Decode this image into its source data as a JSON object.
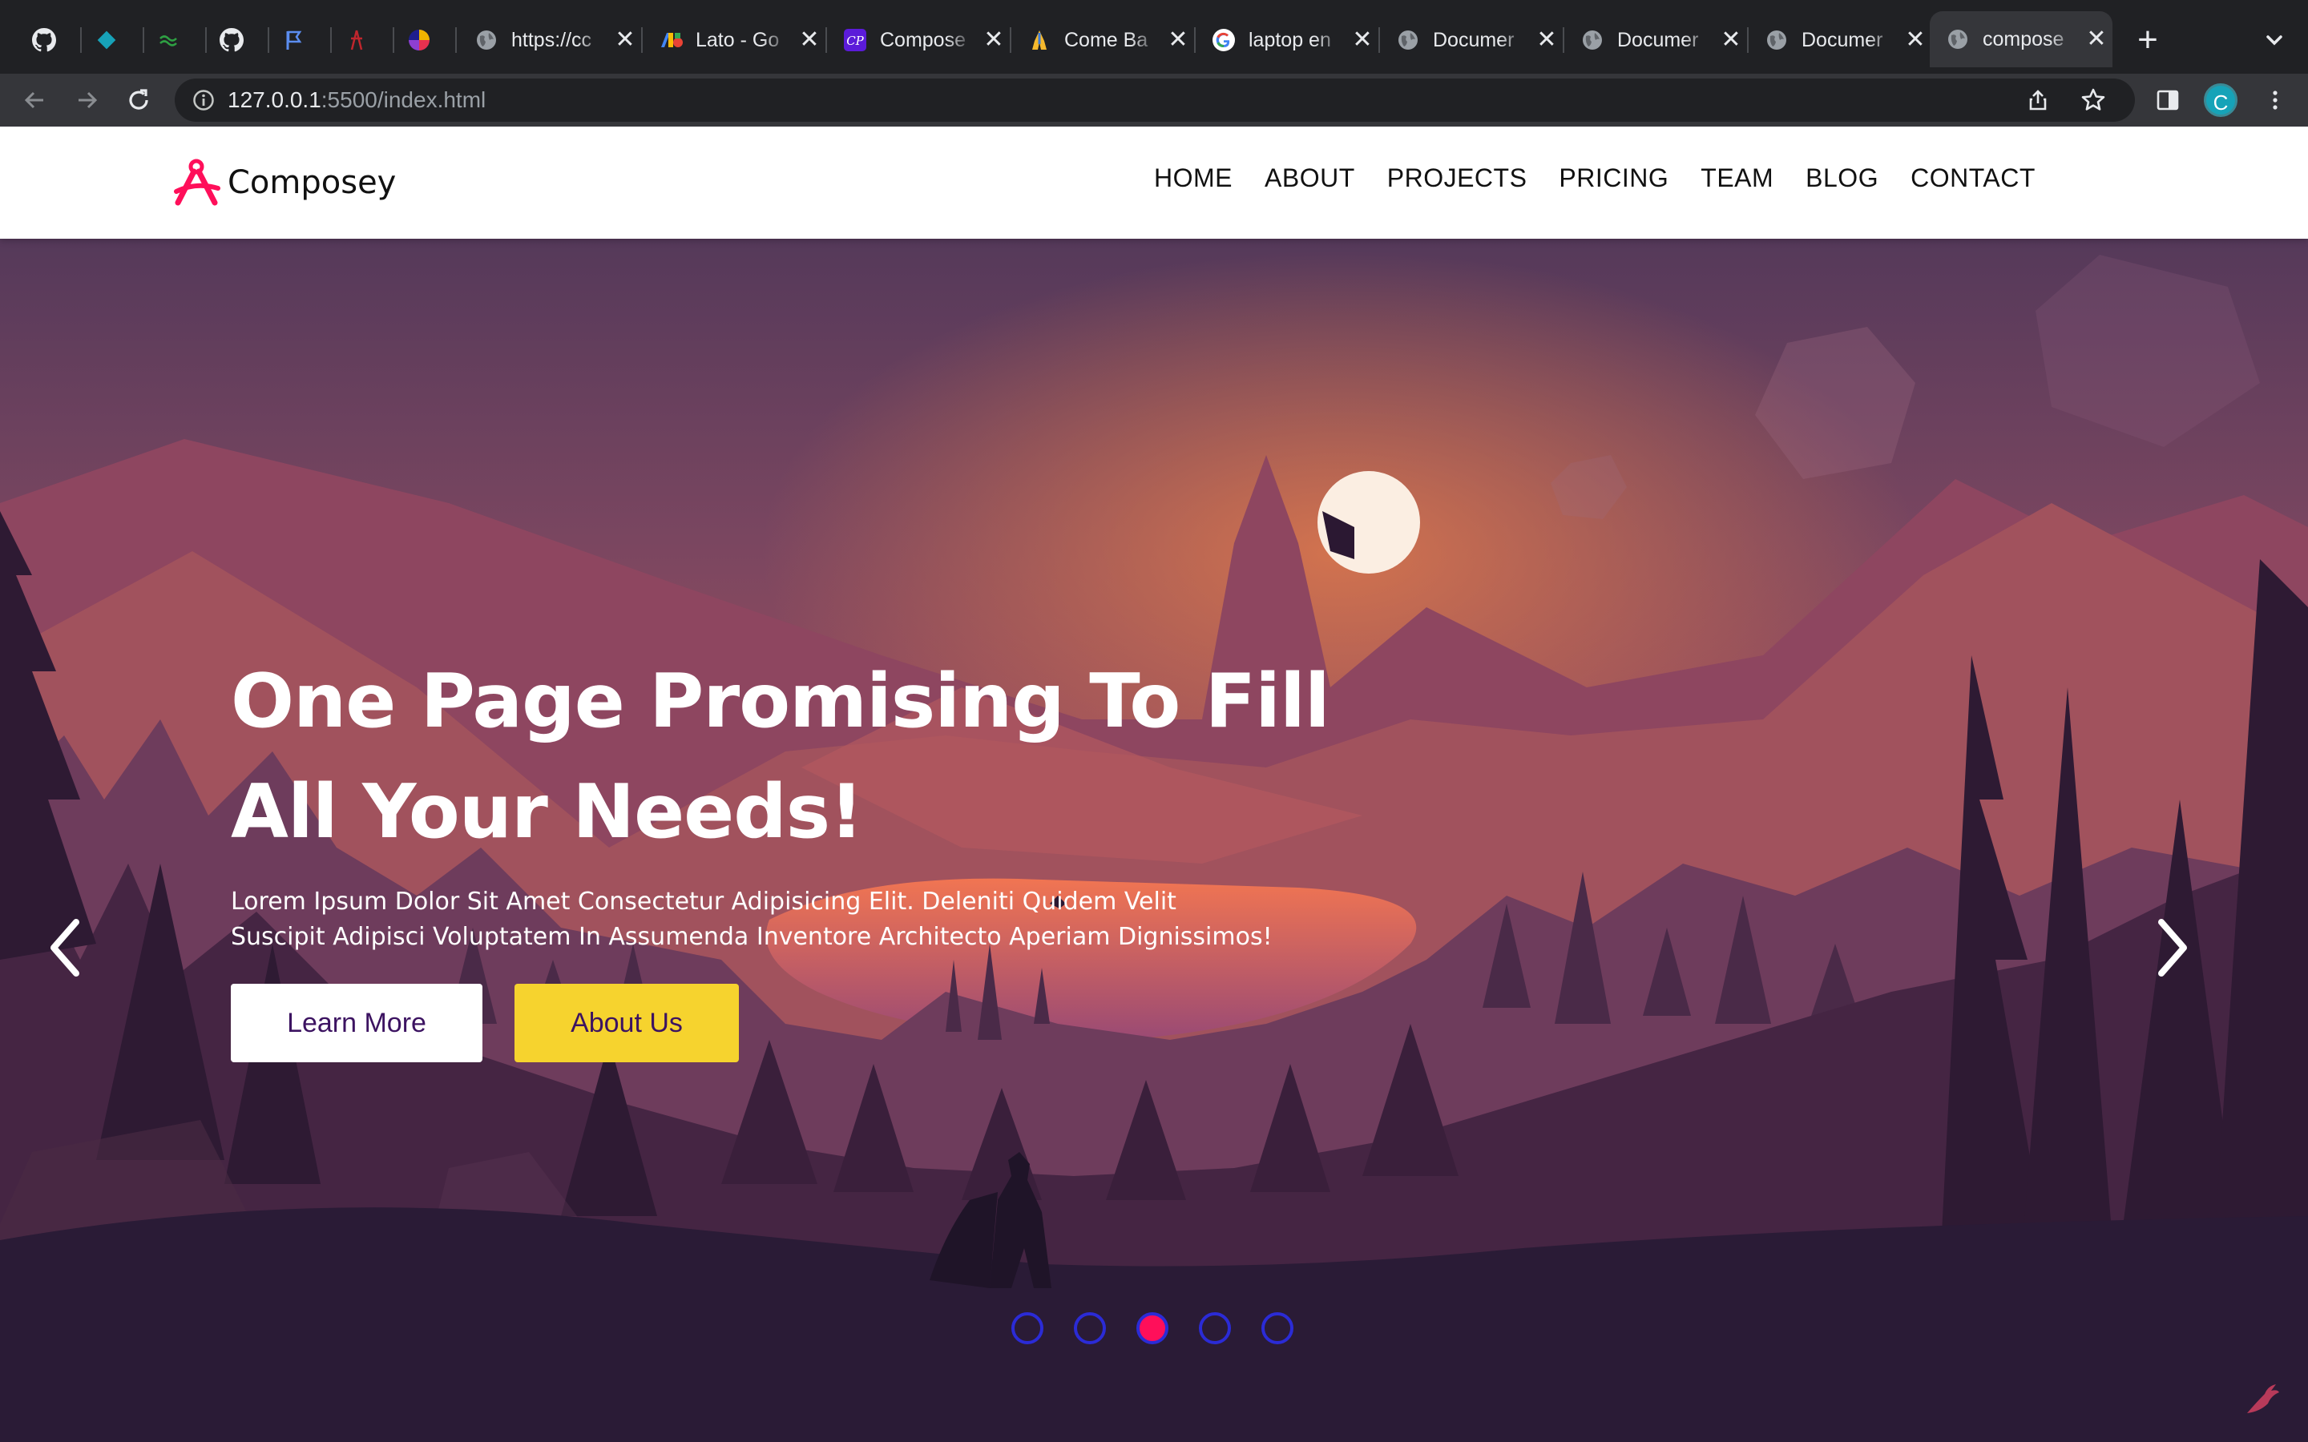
{
  "browser": {
    "tabs": [
      {
        "title": "",
        "icon": "github-icon"
      },
      {
        "title": "",
        "icon": "diamond-icon"
      },
      {
        "title": "",
        "icon": "green-link-icon"
      },
      {
        "title": "",
        "icon": "github-icon"
      },
      {
        "title": "",
        "icon": "flag-icon"
      },
      {
        "title": "",
        "icon": "red-figure-icon"
      },
      {
        "title": "",
        "icon": "color-wheel-icon"
      },
      {
        "title": "https://cc",
        "icon": "globe-icon"
      },
      {
        "title": "Lato - Go",
        "icon": "google-fonts-icon"
      },
      {
        "title": "Compose",
        "icon": "cp-icon"
      },
      {
        "title": "Come Ba",
        "icon": "pray-icon"
      },
      {
        "title": "laptop en",
        "icon": "google-icon"
      },
      {
        "title": "Documer",
        "icon": "globe-icon"
      },
      {
        "title": "Documer",
        "icon": "globe-icon"
      },
      {
        "title": "Documer",
        "icon": "globe-icon"
      },
      {
        "title": "compose",
        "icon": "globe-icon",
        "active": true
      }
    ],
    "url_host": "127.0.0.1",
    "url_rest": ":5500/index.html",
    "profile_initial": "C"
  },
  "site": {
    "brand": "Composey",
    "nav": [
      "HOME",
      "ABOUT",
      "PROJECTS",
      "PRICING",
      "TEAM",
      "BLOG",
      "CONTACT"
    ],
    "hero": {
      "headline_line1": "One Page Promising To Fill",
      "headline_line2": "All Your Needs!",
      "lead": "Lorem Ipsum Dolor Sit Amet Consectetur Adipisicing Elit. Deleniti Quidem Velit Suscipit Adipisci Voluptatem In Assumenda Inventore Architecto Aperiam Dignissimos!",
      "learn_more": "Learn More",
      "about_us": "About Us",
      "slides_total": 5,
      "active_slide": 3
    },
    "colors": {
      "accent": "#ff0f5a",
      "cta_yellow": "#f6d32e",
      "cta_text": "#3c1361",
      "dot_ring": "#2b2bd6"
    }
  }
}
